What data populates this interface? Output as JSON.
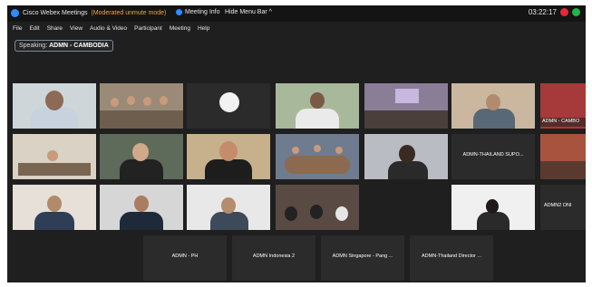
{
  "titlebar": {
    "app_title": "Cisco Webex Meetings",
    "moderated": "(Moderated unmute mode)",
    "meeting_info": "Meeting Info",
    "hide_menu": "Hide Menu Bar",
    "time": "03:22:17",
    "colors": {
      "rec": "#e02a3a",
      "ok": "#24b24b",
      "accent": "#2d8cff"
    }
  },
  "menu": [
    "File",
    "Edit",
    "Share",
    "View",
    "Audio & Video",
    "Participant",
    "Meeting",
    "Help"
  ],
  "speaking": {
    "label": "Speaking:",
    "name": "ADMN - CAMBODIA"
  },
  "tiles": {
    "r2c7": "ADMN-THAILAND SUPO...",
    "r3c7": "ADMN2 ONI",
    "r1c8": "ADMN - CAMBO",
    "bottom": [
      "ADMN - PH",
      "ADMN Indonesia 2",
      "ADMN Singapore - Pang ...",
      "ADMN-Thailand Director ..."
    ]
  }
}
